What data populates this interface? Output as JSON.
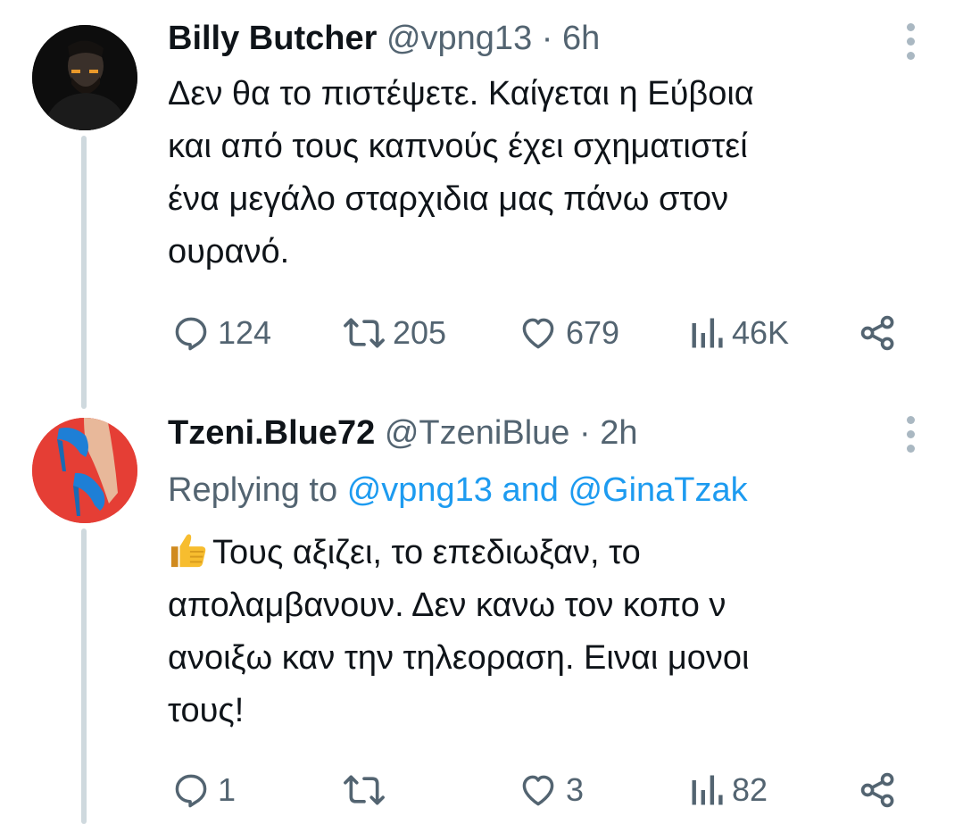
{
  "colors": {
    "text": "#0f1419",
    "secondary": "#536471",
    "link": "#1d9bf0",
    "thread_line": "#cfd9de",
    "avatar2_bg": "#e53e35"
  },
  "tweets": [
    {
      "avatar_icon": "user-avatar-dark",
      "name": "Billy Butcher",
      "handle": "@vpng13",
      "dot": "·",
      "time": "6h",
      "more_icon": "more-vertical-icon",
      "text_lines": [
        "Δεν θα το πιστέψετε. Καίγεται η Εύβοια",
        "και από τους καπνούς έχει σχηματιστεί",
        "ένα μεγάλο σταρχιδια μας πάνω στον",
        "ουρανό."
      ],
      "actions": {
        "reply": "124",
        "retweet": "205",
        "like": "679",
        "views": "46K"
      }
    },
    {
      "avatar_icon": "user-avatar-heels",
      "name": "Tzeni.Blue72",
      "handle": "@TzeniBlue",
      "dot": "·",
      "time": "2h",
      "more_icon": "more-vertical-icon",
      "replying_prefix": "Replying to",
      "replying_to_1": "@vpng13",
      "replying_and": "and",
      "replying_to_2": "@GinaTzak",
      "emoji": "👍",
      "text_lines": [
        "Τους αξιζει, το επεδιωξαν, το",
        "απολαμβανουν. Δεν κανω τον κοπο ν",
        "ανοιξω καν την τηλεοραση. Ειναι μονοι",
        "τους!"
      ],
      "actions": {
        "reply": "1",
        "retweet": "",
        "like": "3",
        "views": "82"
      }
    }
  ]
}
